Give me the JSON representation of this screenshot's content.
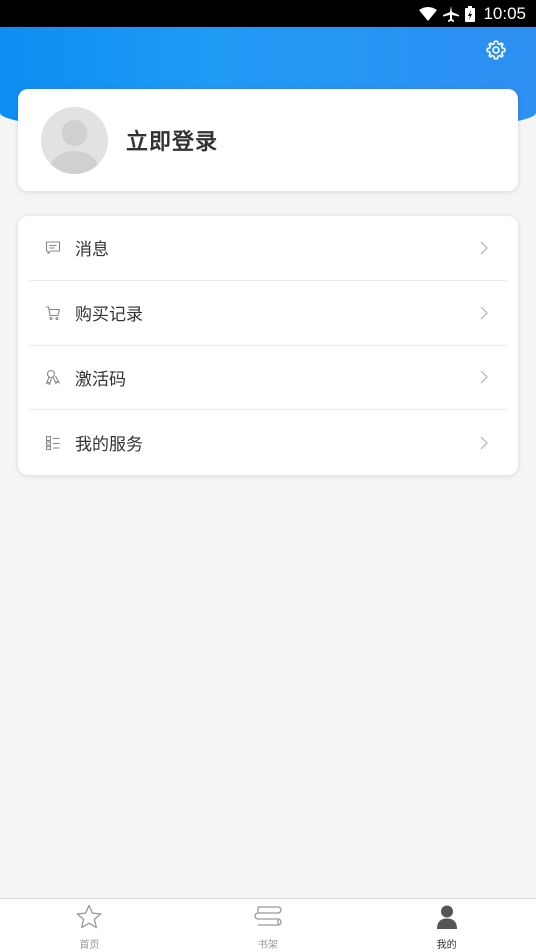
{
  "status_bar": {
    "time": "10:05"
  },
  "profile": {
    "login_label": "立即登录"
  },
  "menu": {
    "items": [
      {
        "label": "消息",
        "icon": "message-icon"
      },
      {
        "label": "购买记录",
        "icon": "cart-icon"
      },
      {
        "label": "激活码",
        "icon": "key-icon"
      },
      {
        "label": "我的服务",
        "icon": "service-list-icon"
      }
    ]
  },
  "bottom_nav": {
    "items": [
      {
        "label": "首页",
        "icon": "star-icon",
        "active": false
      },
      {
        "label": "书架",
        "icon": "bookshelf-icon",
        "active": false
      },
      {
        "label": "我的",
        "icon": "person-icon",
        "active": true
      }
    ]
  },
  "colors": {
    "header_blue": "#1f9af5",
    "text_dark": "#333333",
    "text_muted": "#999999",
    "background": "#f5f5f5"
  }
}
